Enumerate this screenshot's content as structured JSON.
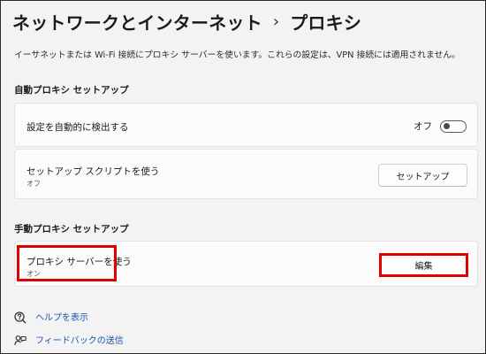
{
  "header": {
    "parent": "ネットワークとインターネット",
    "separator": "›",
    "current": "プロキシ"
  },
  "description": "イーサネットまたは Wi-Fi 接続にプロキシ サーバーを使います。これらの設定は、VPN 接続には適用されません。",
  "auto_section": {
    "heading": "自動プロキシ セットアップ",
    "detect": {
      "title": "設定を自動的に検出する",
      "toggle_label": "オフ",
      "toggle_on": false
    },
    "script": {
      "title": "セットアップ スクリプトを使う",
      "status": "オフ",
      "button_label": "セットアップ"
    }
  },
  "manual_section": {
    "heading": "手動プロキシ セットアップ",
    "proxy_server": {
      "title": "プロキシ サーバーを使う",
      "status": "オン",
      "button_label": "編集"
    }
  },
  "footer": {
    "help": {
      "label": "ヘルプを表示",
      "icon": "help-icon"
    },
    "feedback": {
      "label": "フィードバックの送信",
      "icon": "feedback-icon"
    }
  },
  "colors": {
    "background": "#f3f3f3",
    "card": "#fbfbfb",
    "link": "#1a56a8",
    "highlight": "#e00000"
  }
}
